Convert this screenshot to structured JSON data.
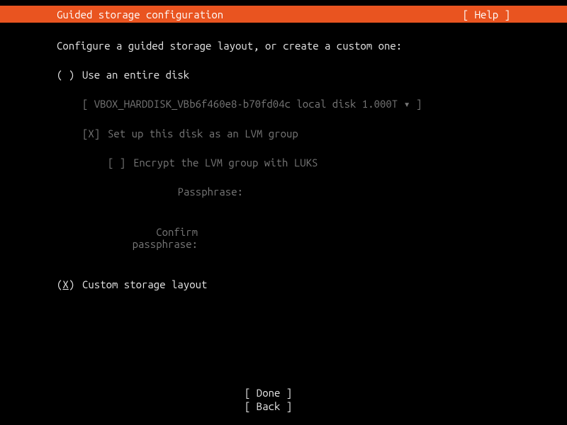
{
  "header": {
    "title": "Guided storage configuration",
    "help": "[ Help ]"
  },
  "instruction": "Configure a guided storage layout, or create a custom one:",
  "options": {
    "use_entire_disk": {
      "radio": "( )",
      "label": "Use an entire disk",
      "disk": "[ VBOX_HARDDISK_VBb6f460e8-b70fd04c local disk 1.000T ▾ ]",
      "lvm": {
        "checkbox": "[X]",
        "label": "Set up this disk as an LVM group"
      },
      "luks": {
        "checkbox": "[ ]",
        "label": "Encrypt the LVM group with LUKS"
      },
      "passphrase_label": "Passphrase:",
      "confirm_label": "Confirm passphrase:"
    },
    "custom": {
      "radio_left": "(",
      "radio_x": "X",
      "radio_right": ")",
      "label": "Custom storage layout"
    }
  },
  "footer": {
    "done": "[ Done      ]",
    "back": "[ Back      ]"
  }
}
